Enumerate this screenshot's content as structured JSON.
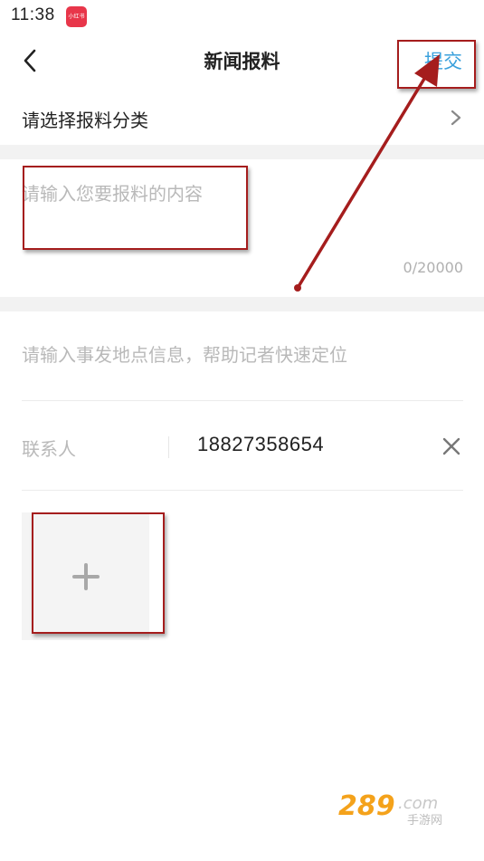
{
  "status_bar": {
    "time": "11:38",
    "app_icon_text": "小红书"
  },
  "nav": {
    "back_icon": "chevron-left-icon",
    "title": "新闻报料",
    "submit_label": "提交"
  },
  "category": {
    "label": "请选择报料分类",
    "icon": "chevron-right-icon"
  },
  "content": {
    "placeholder": "请输入您要报料的内容",
    "value": "",
    "counter": "0/20000"
  },
  "location": {
    "placeholder": "请输入事发地点信息，帮助记者快速定位",
    "value": ""
  },
  "contact": {
    "label": "联系人",
    "value": "18827358654",
    "clear_icon": "close-icon"
  },
  "media": {
    "add_icon": "plus-icon"
  },
  "watermark": {
    "text": "289.com",
    "subtext": "手游网"
  },
  "colors": {
    "accent": "#3aa0dc",
    "annotation": "#a51d1d",
    "placeholder": "#b9b9b9",
    "divider": "#f2f2f2"
  }
}
